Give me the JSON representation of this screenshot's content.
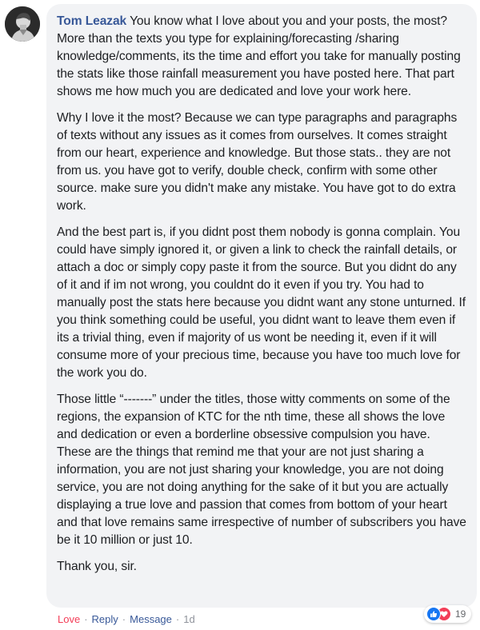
{
  "comment": {
    "author": "Tom Leazak",
    "paragraphs": [
      "You know what I love about you and your posts, the most? More than the texts you type for explaining/forecasting /sharing knowledge/comments, its the time and effort you take for manually posting the stats like those rainfall measurement you have posted here. That part shows me how much you are dedicated and love your work here.",
      "Why I love it the most? Because we can type paragraphs and paragraphs of texts without any issues as it comes from ourselves. It comes straight from our heart, experience and knowledge. But those stats.. they are not from us. you have got to verify, double check, confirm with some other source. make sure you didn't make any mistake. You have got to do extra work.",
      "And the best part is, if you didnt post them nobody is gonna complain. You could have simply ignored it, or given a link to check the rainfall details, or attach a doc or simply copy paste it from the source. But you didnt do any of it and if im not wrong, you couldnt do it even if you try. You had to manually post the stats here because you didnt want any stone unturned. If you think something could be useful, you didnt want to leave them even if its a trivial thing, even if majority of us wont be needing it, even if it will consume more of your precious time, because you have too much love for the work you do.",
      "Those little “-------” under the titles, those witty comments on some of the regions, the expansion of KTC for the nth time, these all shows the love and dedication or even a borderline obsessive compulsion you have. These are the things that remind me that your are not just sharing a information, you are not just sharing your knowledge, you are not doing service, you are not doing anything for the sake of it but you are actually displaying a true love and passion that comes from bottom of your heart and that love remains same irrespective of number of subscribers you have be it 10 million or just 10.",
      "Thank you, sir."
    ]
  },
  "actions": {
    "love": "Love",
    "reply": "Reply",
    "message": "Message",
    "time": "1d",
    "separator": "·"
  },
  "reactions": {
    "count": "19",
    "icons": [
      "like-icon",
      "love-icon"
    ]
  },
  "colors": {
    "author": "#385898",
    "love": "#f33e58",
    "like": "#1877f2",
    "bubble": "#f2f3f5"
  }
}
